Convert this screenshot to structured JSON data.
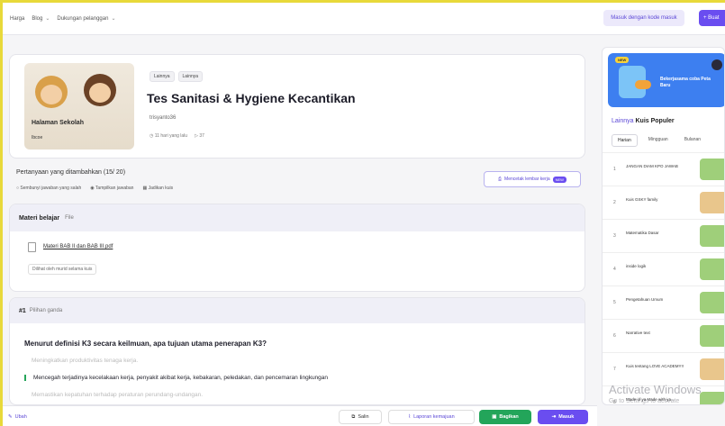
{
  "topbar": {
    "crumbs": [
      "Harga",
      "Blog",
      "Dukungan pelanggan"
    ],
    "code_button": "Masuk dengan kode masuk",
    "create_button": "+ Buat"
  },
  "quiz": {
    "cover_caption": "Halaman Sekolah",
    "cover_sub": "Ibcoe",
    "tags": [
      "Lainnya",
      "Lainnya"
    ],
    "title": "Tes Sanitasi & Hygiene Kecantikan",
    "author": "trisyanto36",
    "time_ago": "11 hari yang lalu",
    "plays": "37"
  },
  "added": {
    "label": "Pertanyaan yang ditambahkan (15/ 20)",
    "options": [
      "Sembunyi jawaban yang salah",
      "Tampilkan jawaban",
      "Jadikan kuis"
    ],
    "print_button": "Mencetak lembar kerja",
    "print_badge": "NEW"
  },
  "materials": {
    "title": "Materi belajar",
    "subtitle": "File",
    "file_name": "Materi BAB II dan BAB III.pdf",
    "viewed": "Dilihat oleh murid selama kuis"
  },
  "question": {
    "number": "#1",
    "type": "Pilihan ganda",
    "text": "Menurut definisi K3 secara keilmuan, apa tujuan utama penerapan K3?",
    "answers": [
      "Meningkatkan produktivitas tenaga kerja.",
      "Mencegah terjadinya kecelakaan kerja, penyakit akibat kerja, kebakaran, peledakan, dan pencemaran lingkungan",
      "Memastikan kepatuhan terhadap peraturan perundang-undangan."
    ]
  },
  "bottombar": {
    "edit": "Ubah",
    "copy": "Salin",
    "report": "Laporan kemajuan",
    "share": "Bagikan",
    "login": "Masuk"
  },
  "sidebar": {
    "promo_badge": "NEW",
    "promo_text": "Bekerjasama coba Peta Baru",
    "title_prefix": "Lainnya",
    "title_rest": "Kuis Populer",
    "tabs": [
      "Harian",
      "Mingguan",
      "Bulanan"
    ],
    "items": [
      {
        "rank": "1",
        "name": "JANGAN DIAM KPO JAWAB"
      },
      {
        "rank": "2",
        "name": "Kuis GSKY family"
      },
      {
        "rank": "3",
        "name": "Matematika Dasar"
      },
      {
        "rank": "4",
        "name": "inside logik"
      },
      {
        "rank": "5",
        "name": "Pengetahuan Umum"
      },
      {
        "rank": "6",
        "name": "Narrative text"
      },
      {
        "rank": "7",
        "name": "Kuis tentang LOVE ACADEMY!!"
      },
      {
        "rank": "8",
        "name": "Made of ya Made with ya..."
      }
    ]
  },
  "watermark": {
    "line1": "Activate Windows",
    "line2": "Go to Settings to activate"
  }
}
